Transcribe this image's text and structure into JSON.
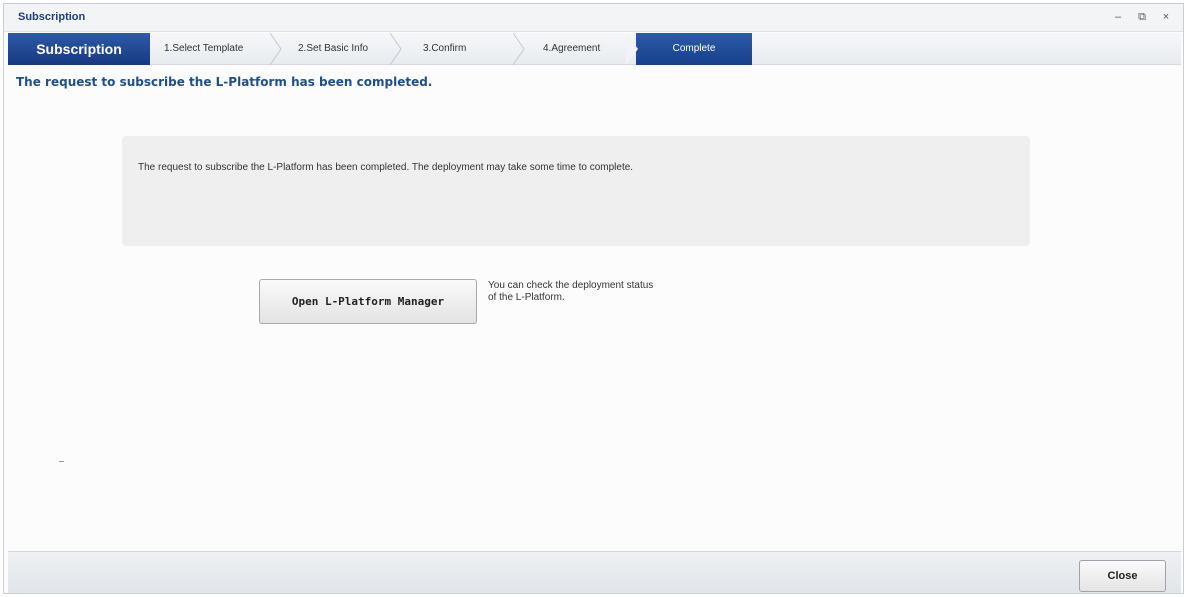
{
  "window": {
    "title": "Subscription",
    "controls": {
      "minimize": "–",
      "restore": "⧉",
      "close": "×"
    }
  },
  "steps": {
    "first": "Subscription",
    "items": [
      {
        "label": "1.Select Template"
      },
      {
        "label": "2.Set Basic Info"
      },
      {
        "label": "3.Confirm"
      },
      {
        "label": "4.Agreement"
      },
      {
        "label": "Complete",
        "active": true
      }
    ]
  },
  "main": {
    "headline": "The request to subscribe the L-Platform has been completed.",
    "message": "The request to subscribe the L-Platform has been completed. The deployment may take some time to complete.",
    "open_button": "Open L-Platform Manager",
    "help_line1": "You can check the deployment status",
    "help_line2": "of the L-Platform."
  },
  "footer": {
    "close_button": "Close"
  },
  "colors": {
    "accent": "#1d4f8c",
    "step_active": "#17408b"
  }
}
